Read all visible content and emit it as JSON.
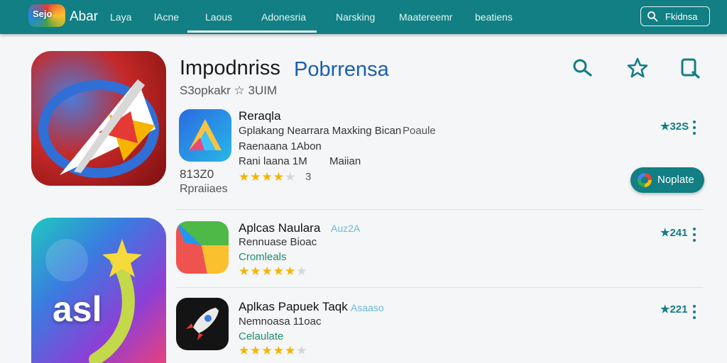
{
  "topbar": {
    "logo_text": "Sejo",
    "app_name": "Abar",
    "tabs": [
      "Laya",
      "lAcne",
      "Laous",
      "Adonesria",
      "Narsking",
      "Maatereemr",
      "beatiens"
    ],
    "search_label": "Fkidnsa"
  },
  "hero": {
    "title_main": "Impodnriss",
    "title_accent": "Pobrrensa",
    "subtitle": "S3opkakr ☆ 3UIM",
    "side_number": "813Z0",
    "side_label": "Rpraiiaes"
  },
  "rows": [
    {
      "title": "Reraqla",
      "line1": "Gplakang Nearrara Maxking Bican",
      "line1_suffix": "Poaule",
      "line2": "Raenaana 1Abon",
      "line3": "Rani laana 1M",
      "line3_right": "Maiian",
      "stars": 4,
      "star_total": 5,
      "star_count": "3",
      "count": "★32S",
      "install_label": "Noplate"
    },
    {
      "title": "Aplcas Naulara",
      "tag": "Auz2A",
      "line1": "Rennuase Bioac",
      "green": "Cromleals",
      "stars": 5,
      "star_total": 6,
      "count": "★241"
    },
    {
      "title": "Aplkas Papuek Taqk",
      "tag": "Asaaso",
      "line1": "Nemnoasa 11oac",
      "green": "Celaulate",
      "stars": 5,
      "star_total": 6,
      "count": "★221"
    }
  ],
  "colors": {
    "topbar": "#117f83",
    "accent_title": "#1b5eb3",
    "star": "#f4b400",
    "teal_text": "#157c86"
  },
  "icons": {
    "search": "search-icon",
    "zoom": "magnifier-icon",
    "favorite": "star-outline-icon",
    "find": "find-icon",
    "more": "kebab-menu-icon"
  }
}
